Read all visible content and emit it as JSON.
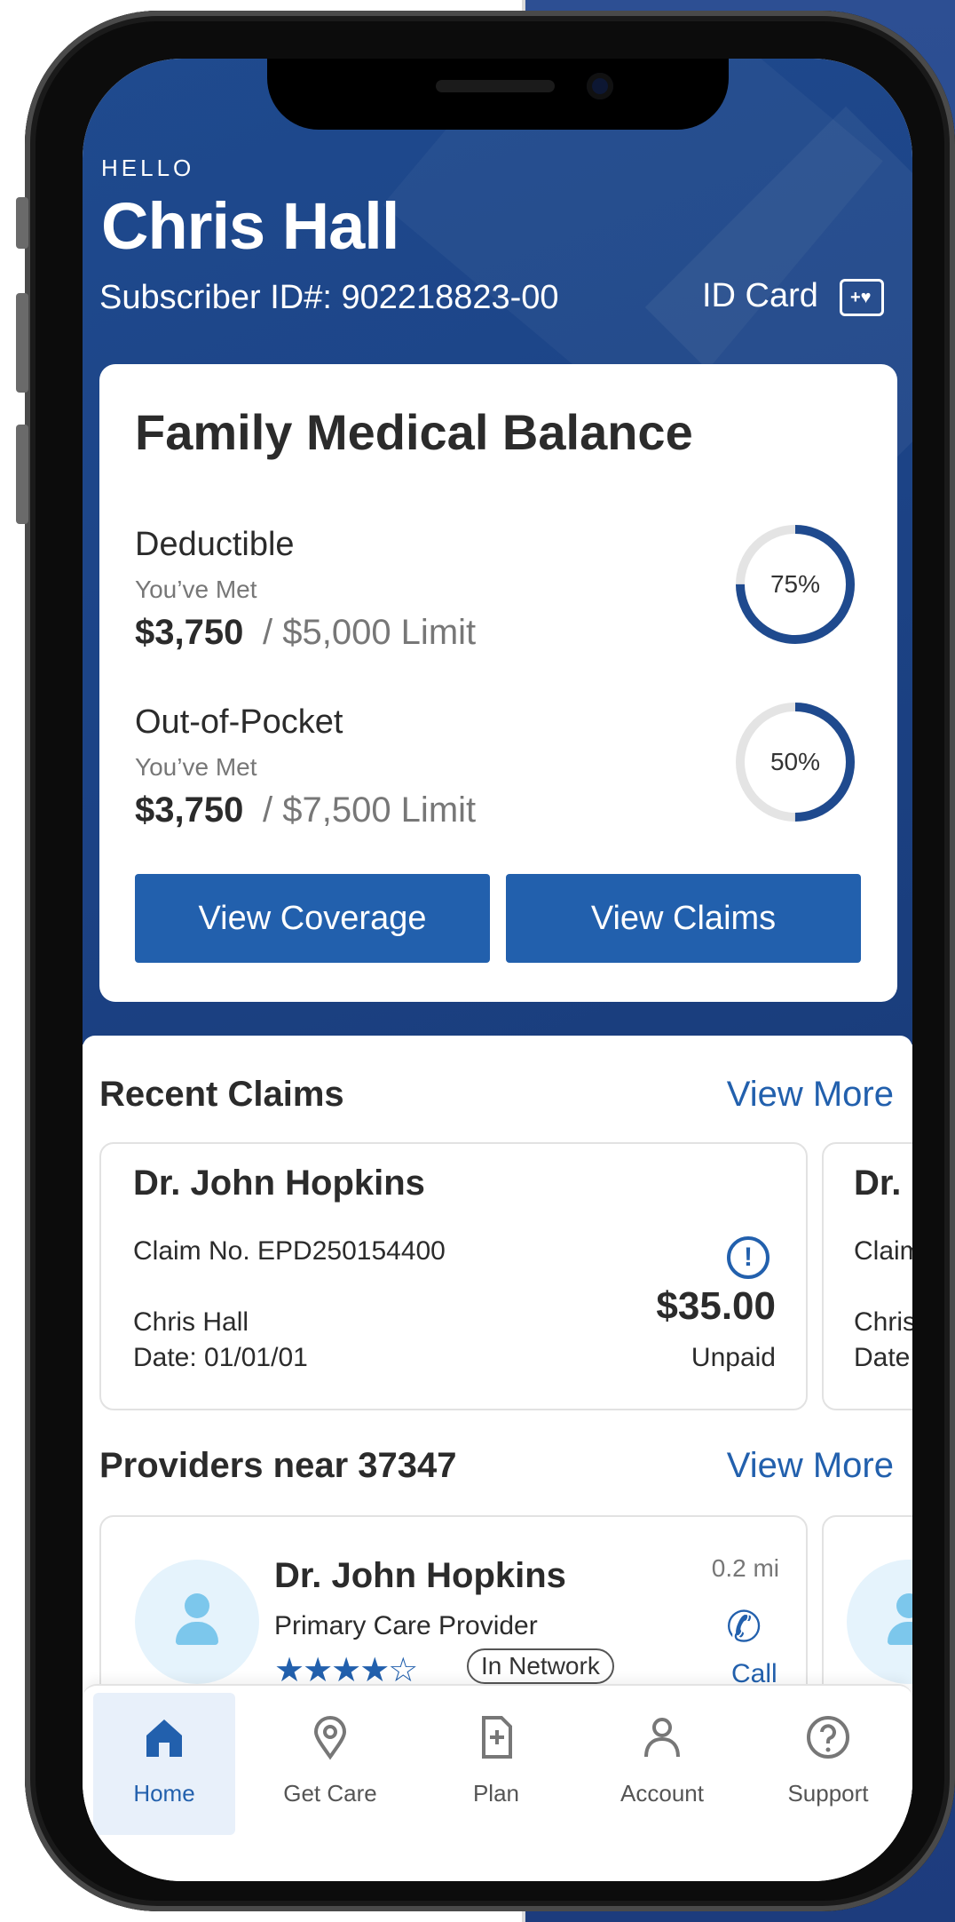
{
  "header": {
    "greeting": "HELLO",
    "user_name": "Chris Hall",
    "subscriber_id": "Subscriber ID#: 902218823-00",
    "id_card_label": "ID Card"
  },
  "balance": {
    "title": "Family Medical Balance",
    "deductible": {
      "label": "Deductible",
      "met_label": "You’ve Met",
      "met_amount": "$3,750",
      "limit": "/ $5,000 Limit",
      "percent_text": "75%",
      "percent": 75
    },
    "out_of_pocket": {
      "label": "Out-of-Pocket",
      "met_label": "You’ve Met",
      "met_amount": "$3,750",
      "limit": "/ $7,500 Limit",
      "percent_text": "50%",
      "percent": 50
    },
    "view_coverage_label": "View Coverage",
    "view_claims_label": "View Claims"
  },
  "recent_claims": {
    "title": "Recent Claims",
    "view_more_label": "View More",
    "claims": [
      {
        "doctor": "Dr. John Hopkins",
        "claim_no": "Claim No. EPD250154400",
        "patient": "Chris Hall",
        "date": "Date: 01/01/01",
        "amount": "$35.00",
        "status": "Unpaid",
        "alert_icon": "alert-circle-icon"
      },
      {
        "doctor": "Dr.",
        "claim_no": "Claim",
        "patient": "Chris",
        "date": "Date"
      }
    ]
  },
  "providers": {
    "title": "Providers near 37347",
    "view_more_label": "View More",
    "items": [
      {
        "name": "Dr. John Hopkins",
        "type": "Primary Care Provider",
        "rating": 4.5,
        "stars_display": "★★★★☆",
        "network_badge": "In Network",
        "distance": "0.2 mi",
        "call_label": "Call",
        "phone_icon": "phone-icon"
      }
    ]
  },
  "tabbar": {
    "items": [
      {
        "label": "Home",
        "icon": "home-icon",
        "active": true
      },
      {
        "label": "Get Care",
        "icon": "location-pin-icon",
        "active": false
      },
      {
        "label": "Plan",
        "icon": "document-plus-icon",
        "active": false
      },
      {
        "label": "Account",
        "icon": "person-icon",
        "active": false
      },
      {
        "label": "Support",
        "icon": "question-circle-icon",
        "active": false
      }
    ]
  },
  "colors": {
    "brand_blue": "#2260ad",
    "header_blue": "#1f4a8e",
    "ring_track": "#e4e4e4",
    "ring_fill": "#1f4a8e"
  }
}
